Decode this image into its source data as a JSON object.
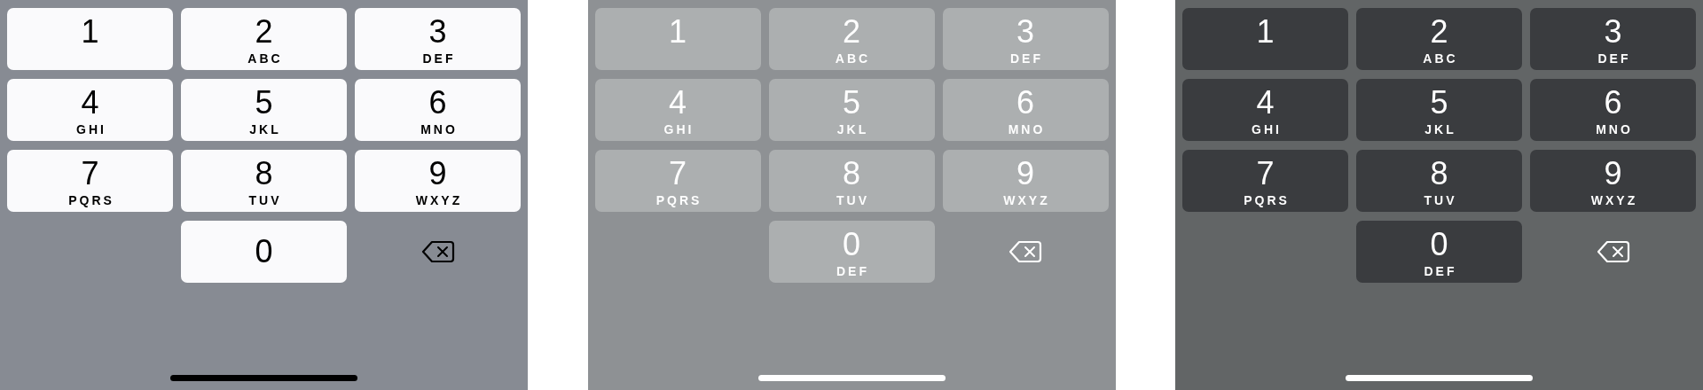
{
  "panels": [
    {
      "kind": "light",
      "keys": [
        {
          "digit": "1"
        },
        {
          "digit": "2",
          "letters": "ABC"
        },
        {
          "digit": "3",
          "letters": "DEF"
        },
        {
          "digit": "4",
          "letters": "GHI"
        },
        {
          "digit": "5",
          "letters": "JKL"
        },
        {
          "digit": "6",
          "letters": "MNO"
        },
        {
          "digit": "7",
          "letters": "PQRS"
        },
        {
          "digit": "8",
          "letters": "TUV"
        },
        {
          "digit": "9",
          "letters": "WXYZ"
        },
        {
          "digit": "0"
        }
      ]
    },
    {
      "kind": "gray",
      "keys": [
        {
          "digit": "1"
        },
        {
          "digit": "2",
          "letters": "ABC"
        },
        {
          "digit": "3",
          "letters": "DEF"
        },
        {
          "digit": "4",
          "letters": "GHI"
        },
        {
          "digit": "5",
          "letters": "JKL"
        },
        {
          "digit": "6",
          "letters": "MNO"
        },
        {
          "digit": "7",
          "letters": "PQRS"
        },
        {
          "digit": "8",
          "letters": "TUV"
        },
        {
          "digit": "9",
          "letters": "WXYZ"
        },
        {
          "digit": "0",
          "letters": "DEF"
        }
      ]
    },
    {
      "kind": "dark",
      "keys": [
        {
          "digit": "1"
        },
        {
          "digit": "2",
          "letters": "ABC"
        },
        {
          "digit": "3",
          "letters": "DEF"
        },
        {
          "digit": "4",
          "letters": "GHI"
        },
        {
          "digit": "5",
          "letters": "JKL"
        },
        {
          "digit": "6",
          "letters": "MNO"
        },
        {
          "digit": "7",
          "letters": "PQRS"
        },
        {
          "digit": "8",
          "letters": "TUV"
        },
        {
          "digit": "9",
          "letters": "WXYZ"
        },
        {
          "digit": "0",
          "letters": "DEF"
        }
      ]
    }
  ]
}
